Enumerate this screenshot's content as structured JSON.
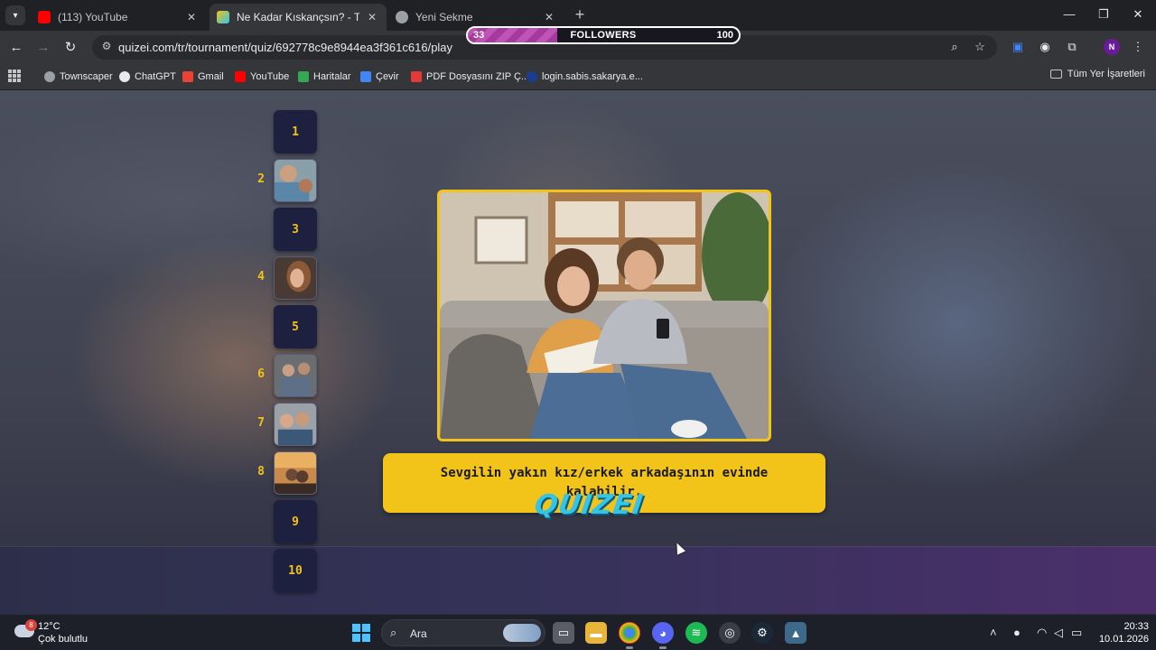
{
  "browser": {
    "tabs": [
      {
        "title": "(113) YouTube",
        "icon": "youtube-icon",
        "color": "#ff0000",
        "active": false
      },
      {
        "title": "Ne Kadar Kıskançsın? - Tier List",
        "icon": "quizei-favicon",
        "color": "#f2c318",
        "active": true
      },
      {
        "title": "Yeni Sekme",
        "icon": "chrome-icon",
        "color": "#9aa0a6",
        "active": false
      }
    ],
    "url": "quizei.com/tr/tournament/quiz/692778c9e8944ea3f361c616/play",
    "profile_initial": "N"
  },
  "followers": {
    "current": "33",
    "label": "FOLLOWERS",
    "goal": "100",
    "progress": 0.33
  },
  "bookmarks": [
    {
      "label": "Townscaper",
      "icon": "globe-icon",
      "color": "#9aa0a6"
    },
    {
      "label": "ChatGPT",
      "icon": "chatgpt-icon",
      "color": "#e8eaed"
    },
    {
      "label": "Gmail",
      "icon": "gmail-icon",
      "color": "#ea4335"
    },
    {
      "label": "YouTube",
      "icon": "youtube-icon",
      "color": "#ff0000"
    },
    {
      "label": "Haritalar",
      "icon": "maps-icon",
      "color": "#34a853"
    },
    {
      "label": "Çevir",
      "icon": "translate-icon",
      "color": "#4285f4"
    },
    {
      "label": "PDF Dosyasını ZIP Ç...",
      "icon": "pdf-icon",
      "color": "#e53935"
    },
    {
      "label": "login.sabis.sakarya.e...",
      "icon": "sabis-icon",
      "color": "#1a3d8f"
    }
  ],
  "all_bookmarks": "Tüm Yer İşaretleri",
  "quiz": {
    "ranks": [
      {
        "num": "1",
        "filled": false
      },
      {
        "num": "2",
        "filled": true
      },
      {
        "num": "3",
        "filled": false
      },
      {
        "num": "4",
        "filled": true
      },
      {
        "num": "5",
        "filled": false
      },
      {
        "num": "6",
        "filled": true
      },
      {
        "num": "7",
        "filled": true
      },
      {
        "num": "8",
        "filled": true
      },
      {
        "num": "9",
        "filled": false
      },
      {
        "num": "10",
        "filled": false
      }
    ],
    "question": "Sevgilin yakın kız/erkek arkadaşının evinde kalabilir.",
    "logo": "QUIZEI",
    "accent": "#f2c318"
  },
  "taskbar": {
    "temperature": "12°C",
    "condition": "Çok bulutlu",
    "weather_badge": "8",
    "search_placeholder": "Ara",
    "time": "20:33",
    "date": "10.01.2026"
  }
}
